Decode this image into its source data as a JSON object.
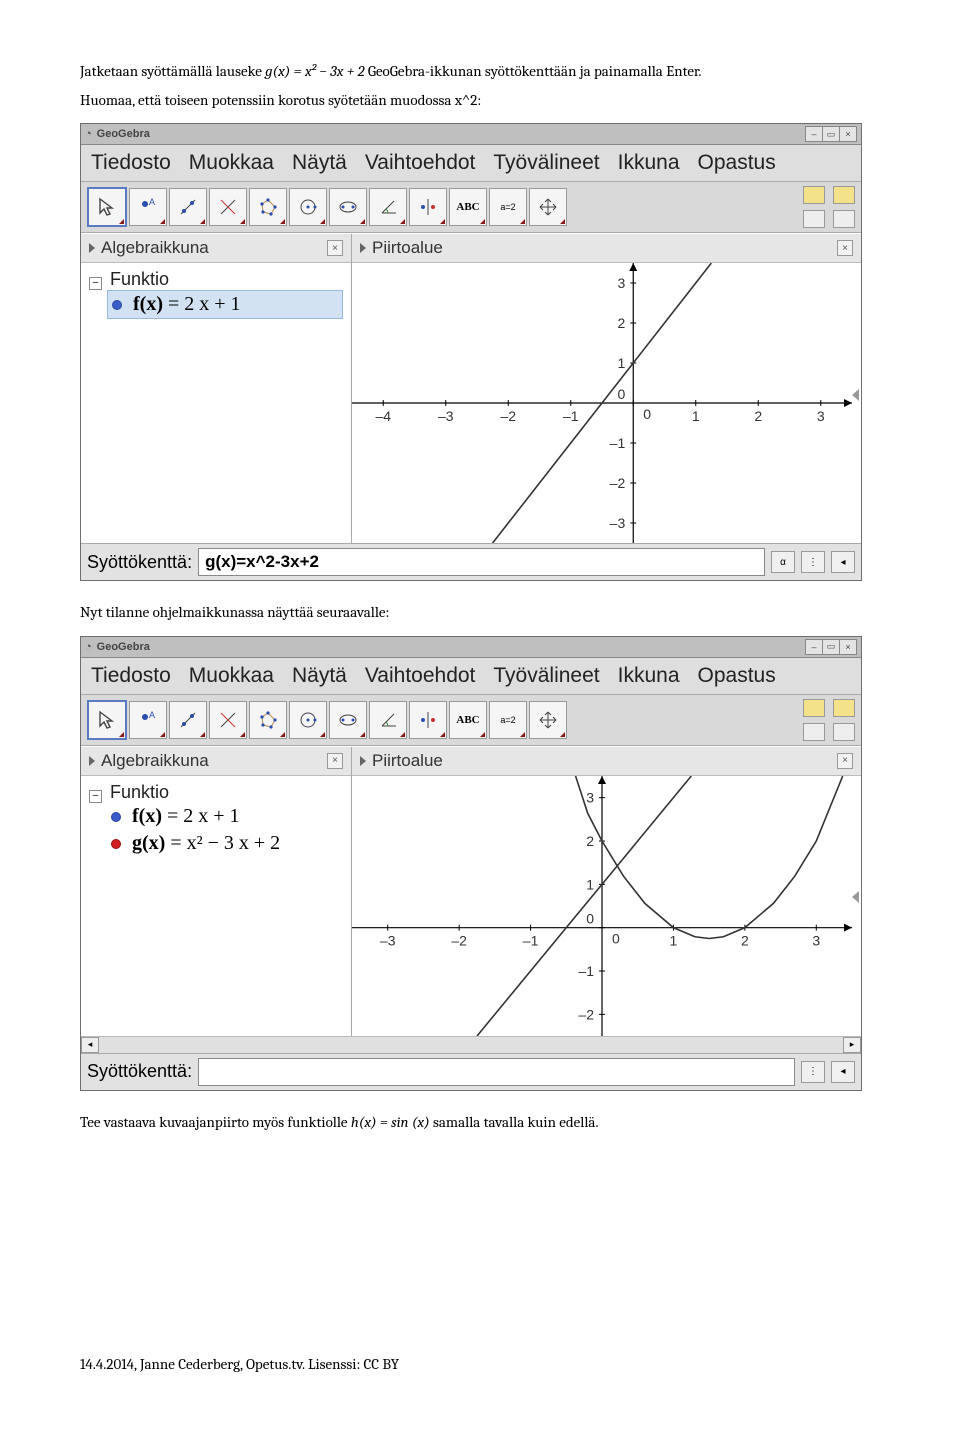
{
  "intro_text_1a": "Jatketaan syöttämällä lauseke ",
  "intro_text_1_expr": "g(x) = x² − 3x + 2",
  "intro_text_1b": " GeoGebra-ikkunan syöttökenttään ja painamalla Enter.",
  "intro_text_2": "Huomaa, että toiseen potenssiin korotus syötetään muodossa x^2:",
  "middle_text": "Nyt tilanne ohjelmaikkunassa näyttää seuraavalle:",
  "end_text_a": "Tee vastaava kuvaajanpiirto myös funktiolle ",
  "end_text_expr": "h(x) = sin (x)",
  "end_text_b": " samalla tavalla kuin edellä.",
  "footer_text": "14.4.2014, Janne Cederberg, Opetus.tv. Lisenssi: CC BY",
  "app": {
    "title": "GeoGebra",
    "menus": [
      "Tiedosto",
      "Muokkaa",
      "Näytä",
      "Vaihtoehdot",
      "Työvälineet",
      "Ikkuna",
      "Opastus"
    ],
    "panels": {
      "algebra": "Algebraikkuna",
      "graphics": "Piirtoalue"
    },
    "funktio_label": "Funktio",
    "input_label": "Syöttökenttä:",
    "abc_label": "ABC",
    "a2_label": "a=2"
  },
  "window1": {
    "functions": [
      {
        "name": "f(x)",
        "expr": "= 2 x + 1",
        "color": "blue",
        "selected": true
      }
    ],
    "input_value": "g(x)=x^2-3x+2",
    "chart_data": {
      "type": "line",
      "title": "",
      "xlabel": "",
      "ylabel": "",
      "xlim": [
        -4.5,
        3.5
      ],
      "ylim": [
        -3.5,
        3.5
      ],
      "xticks": [
        -4,
        -3,
        -2,
        -1,
        0,
        1,
        2,
        3
      ],
      "yticks": [
        -3,
        -2,
        -1,
        0,
        1,
        2,
        3
      ],
      "series": [
        {
          "name": "f(x)=2x+1",
          "color": "#333",
          "points": [
            [
              -2.25,
              -3.5
            ],
            [
              -2,
              -3
            ],
            [
              -1.5,
              -2
            ],
            [
              -1,
              -1
            ],
            [
              -0.5,
              0
            ],
            [
              0,
              1
            ],
            [
              0.5,
              2
            ],
            [
              1,
              3
            ],
            [
              1.25,
              3.5
            ]
          ]
        }
      ]
    }
  },
  "window2": {
    "functions": [
      {
        "name": "f(x)",
        "expr": "= 2 x + 1",
        "color": "blue",
        "selected": false
      },
      {
        "name": "g(x)",
        "expr": "= x² − 3 x + 2",
        "color": "red",
        "selected": false
      }
    ],
    "input_value": "",
    "chart_data": {
      "type": "line",
      "title": "",
      "xlabel": "",
      "ylabel": "",
      "xlim": [
        -3.5,
        3.5
      ],
      "ylim": [
        -2.5,
        3.5
      ],
      "xticks": [
        -3,
        -2,
        -1,
        0,
        1,
        2,
        3
      ],
      "yticks": [
        -2,
        -1,
        0,
        1,
        2,
        3
      ],
      "series": [
        {
          "name": "f(x)=2x+1",
          "color": "#333",
          "points": [
            [
              -1.75,
              -2.5
            ],
            [
              -1.5,
              -2
            ],
            [
              -1,
              -1
            ],
            [
              -0.5,
              0
            ],
            [
              0,
              1
            ],
            [
              0.5,
              2
            ],
            [
              1,
              3
            ],
            [
              1.25,
              3.5
            ]
          ]
        },
        {
          "name": "g(x)=x^2-3x+2",
          "color": "#333",
          "points": [
            [
              -0.37,
              3.5
            ],
            [
              -0.2,
              2.64
            ],
            [
              0,
              2
            ],
            [
              0.3,
              1.19
            ],
            [
              0.6,
              0.56
            ],
            [
              1,
              0
            ],
            [
              1.3,
              -0.21
            ],
            [
              1.5,
              -0.25
            ],
            [
              1.7,
              -0.21
            ],
            [
              2,
              0
            ],
            [
              2.4,
              0.56
            ],
            [
              2.7,
              1.19
            ],
            [
              3,
              2
            ],
            [
              3.37,
              3.5
            ]
          ]
        }
      ]
    }
  }
}
